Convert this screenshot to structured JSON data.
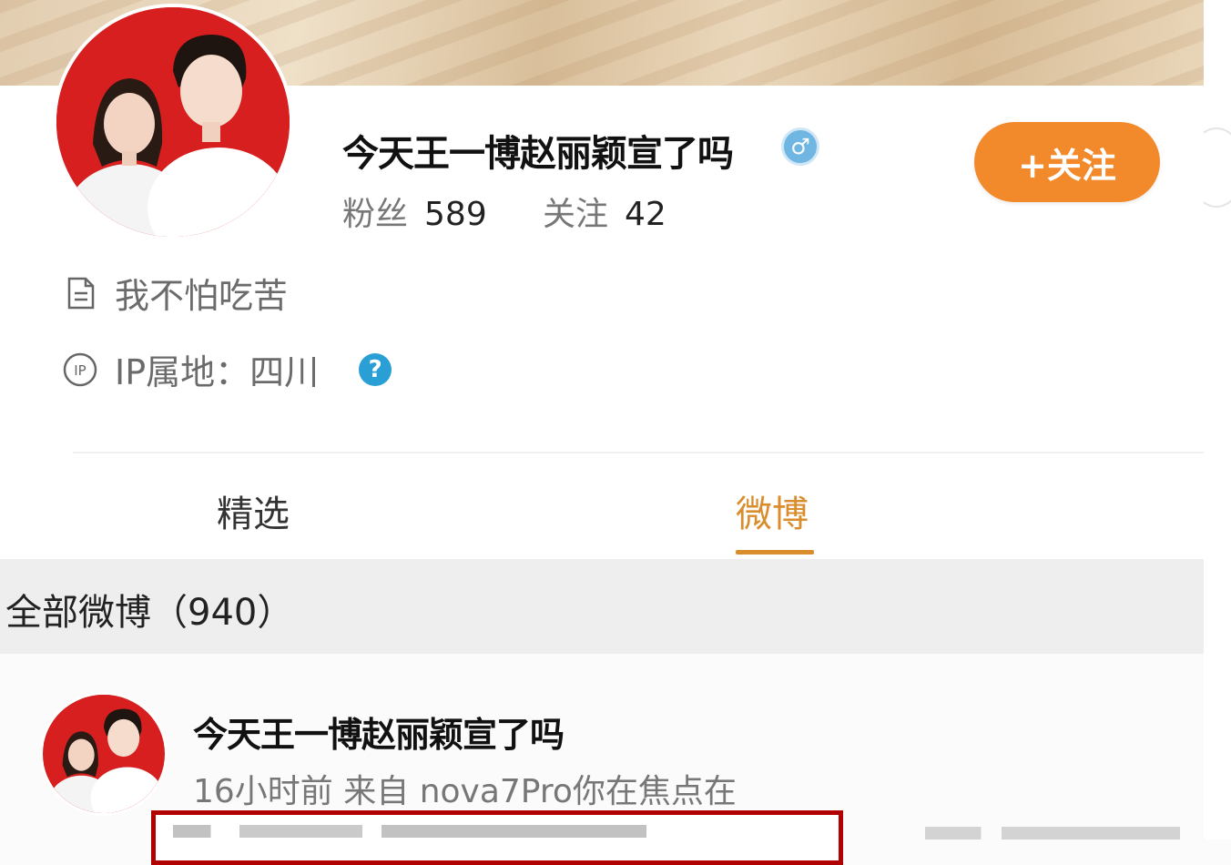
{
  "profile": {
    "username": "今天王一博赵丽颖宣了吗",
    "verified_badge_glyph": "♂",
    "followers_label": "粉丝",
    "followers_count": "589",
    "following_label": "关注",
    "following_count": "42",
    "follow_button_label": "+关注",
    "bio": "我不怕吃苦",
    "ip_location": "IP属地：四川",
    "help_glyph": "?"
  },
  "tabs": [
    {
      "label": "精选",
      "active": false
    },
    {
      "label": "微博",
      "active": true
    }
  ],
  "section": {
    "title": "全部微博（940）"
  },
  "post": {
    "author": "今天王一博赵丽颖宣了吗",
    "meta": "16小时前 来自 nova7Pro你在焦点在"
  },
  "colors": {
    "accent": "#f28a2b",
    "active_tab": "#d98d2d",
    "avatar_bg": "#d71f1f",
    "highlight_border": "#b00000"
  }
}
